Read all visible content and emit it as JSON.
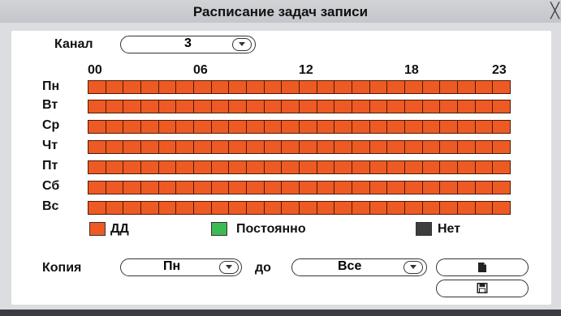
{
  "title": "Расписание задач записи",
  "close_symbol": "╳",
  "channel": {
    "label": "Канал",
    "value": "3"
  },
  "hours": [
    "00",
    "06",
    "12",
    "18",
    "23"
  ],
  "days": [
    "Пн",
    "Вт",
    "Ср",
    "Чт",
    "Пт",
    "Сб",
    "Вс"
  ],
  "hours_per_day": 24,
  "schedule_mode_all": "ДД",
  "legend": [
    {
      "label": "ДД",
      "color": "#ee5a24"
    },
    {
      "label": "Постоянно",
      "color": "#3cba54"
    },
    {
      "label": "Нет",
      "color": "#3d3d3d"
    }
  ],
  "copy": {
    "label": "Копия",
    "from_value": "Пн",
    "to_label": "до",
    "to_value": "Все"
  },
  "buttons": {
    "copy_icon": "copy-icon",
    "save_icon": "save-icon"
  }
}
